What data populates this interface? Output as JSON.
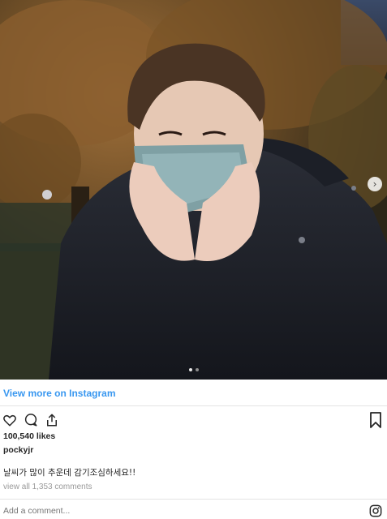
{
  "post": {
    "view_more_label": "View more on Instagram",
    "likes": "100,540 likes",
    "username": "pockyjr",
    "caption": "날씨가 많이 추운데 감기조심하세요!!",
    "view_all_comments": "view all 1,353 comments",
    "comment_placeholder": "Add a comment...",
    "carousel_count": 2,
    "carousel_active": 1
  },
  "icons": {
    "like": "heart-icon",
    "comment": "comment-icon",
    "share": "share-icon",
    "save": "bookmark-icon",
    "brand": "instagram-icon",
    "next": "chevron-right-icon"
  },
  "colors": {
    "link": "#3897f0",
    "muted": "#999999",
    "text": "#262626"
  }
}
